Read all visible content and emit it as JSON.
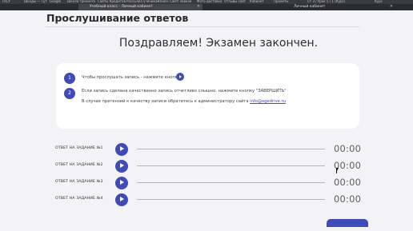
{
  "browser": {
    "bookmarks": [
      "ТПСУ",
      "Шкоды — Тут",
      "Google",
      "Школа тренинга",
      "Сайты Кредитов",
      "Рассылка ученикам",
      "Поиск Сайт",
      "Главная",
      "Фото доставка",
      "Отзывы сайт",
      "Кабинет",
      "Проекты",
      "Ст 3 / Урок 5 / 1 (Курс)",
      "Курс"
    ],
    "tabs": [
      {
        "title": "Учебный класс - Личный кабинет",
        "active": true
      },
      {
        "title": "Личный кабинет",
        "active": false
      }
    ]
  },
  "page": {
    "title": "Прослушивание ответов",
    "congrats": "Поздравляем! Экзамен закончен."
  },
  "info": {
    "step1_number": "1",
    "step1_text": "Чтобы прослушать запись - нажмите кнопку",
    "step2_number": "2",
    "step2_text": "Если запись сделана качественно запись отчетливо слышно, нажмите кнопку \"ЗАВЕРШИТЬ\"",
    "complaint_text": "В случае претензий к качеству записи обратитесь к администратору сайта",
    "email": "info@egedrive.ru"
  },
  "answers": [
    {
      "label": "ОТВЕТ НА ЗАДАНИЕ №1",
      "time": "00:00"
    },
    {
      "label": "ОТВЕТ НА ЗАДАНИЕ №2",
      "time": "00:00"
    },
    {
      "label": "ОТВЕТ НА ЗАДАНИЕ №3",
      "time": "00:00"
    },
    {
      "label": "ОТВЕТ НА ЗАДАНИЕ №4",
      "time": "00:00"
    }
  ],
  "colors": {
    "accent": "#3f4bb6",
    "background": "#f3f3f5",
    "card": "#ffffff"
  },
  "icons": {
    "play": "play-icon",
    "close": "close-icon"
  }
}
